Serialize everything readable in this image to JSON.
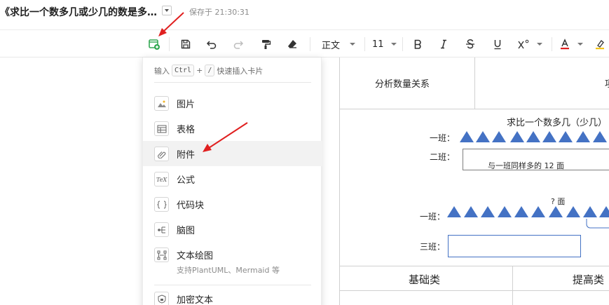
{
  "header": {
    "doc_title": "《求比一个数多几或少几的数是多…",
    "save_status": "保存于 21:30:31"
  },
  "toolbar": {
    "insert_icon": "insert-card-icon",
    "paragraph_style": "正文",
    "font_size": "11",
    "accent_color": "#34a853",
    "font_color": "#e02020",
    "highlight_color": "#f5c518"
  },
  "menu": {
    "hint_prefix": "输入",
    "hint_key1": "Ctrl",
    "hint_plus": "+",
    "hint_key2": "/",
    "hint_suffix": "快速插入卡片",
    "items": [
      {
        "label": "图片",
        "icon": "image-icon"
      },
      {
        "label": "表格",
        "icon": "table-icon"
      },
      {
        "label": "附件",
        "icon": "attachment-icon"
      },
      {
        "label": "公式",
        "icon": "formula-icon"
      },
      {
        "label": "代码块",
        "icon": "code-block-icon"
      },
      {
        "label": "脑图",
        "icon": "mind-map-icon"
      },
      {
        "label": "文本绘图",
        "icon": "text-diagram-icon",
        "sub": "支持PlantUML、Mermaid 等"
      },
      {
        "label": "加密文本",
        "icon": "encrypted-text-icon"
      }
    ]
  },
  "document": {
    "header_cell_1": "分析数量关系",
    "header_cell_2": "项",
    "problem_title": "求比一个数多几（少几）",
    "class_1": "一班：",
    "class_2": "二班：",
    "class_2_box_text": "与一班同样多的 12 面",
    "question": "? 面",
    "class_1b": "一班：",
    "class_3": "三班：",
    "category_basic": "基础类",
    "category_advanced": "提高类"
  }
}
